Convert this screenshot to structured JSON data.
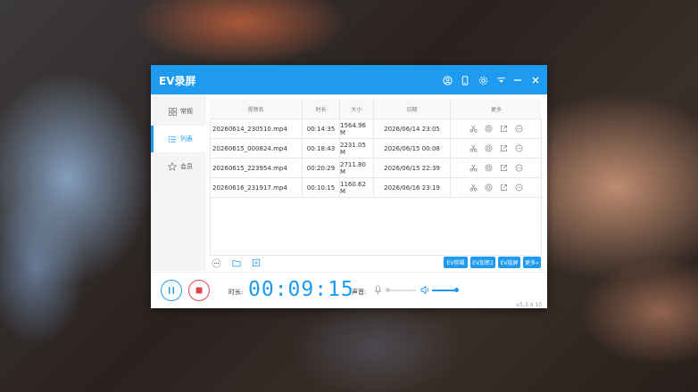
{
  "app": {
    "title": "EV录屏",
    "accent": "#1e9bf0",
    "version": "v5.3.4.10"
  },
  "titlebar_icons": [
    "user-icon",
    "phone-icon",
    "settings-icon",
    "download-icon",
    "minimize-icon",
    "close-icon"
  ],
  "sidebar": {
    "items": [
      {
        "label": "常规",
        "icon": "grid-icon",
        "active": false
      },
      {
        "label": "列表",
        "icon": "list-icon",
        "active": true
      },
      {
        "label": "会员",
        "icon": "star-icon",
        "active": false
      }
    ]
  },
  "table": {
    "headers": [
      "视频名",
      "时长",
      "大小",
      "日期",
      "更多"
    ],
    "rows": [
      {
        "name": "20260614_230510.mp4",
        "duration": "00:14:35",
        "size": "1564.96 M",
        "date": "2026/06/14 23:05"
      },
      {
        "name": "20260615_000824.mp4",
        "duration": "00:18:43",
        "size": "2231.05 M",
        "date": "2026/06/15 00:08"
      },
      {
        "name": "20260615_223954.mp4",
        "duration": "00:20:29",
        "size": "2711.80 M",
        "date": "2026/06/15 22:39"
      },
      {
        "name": "20260616_231917.mp4",
        "duration": "00:10:15",
        "size": "1160.62 M",
        "date": "2026/06/16 23:19"
      }
    ],
    "row_actions": [
      "cut-icon",
      "compress-icon",
      "share-icon",
      "more-icon"
    ]
  },
  "toolbar": {
    "buttons": [
      "EV剪辑",
      "EV加密2",
      "EV投屏",
      "更多»"
    ],
    "icons": [
      "more-dots-icon",
      "folder-icon",
      "import-icon"
    ]
  },
  "recorder": {
    "duration_label": "时长:",
    "timer": "00:09:15",
    "sound_label": "声音:",
    "mic_level": 0,
    "speaker_level": 1.0
  }
}
